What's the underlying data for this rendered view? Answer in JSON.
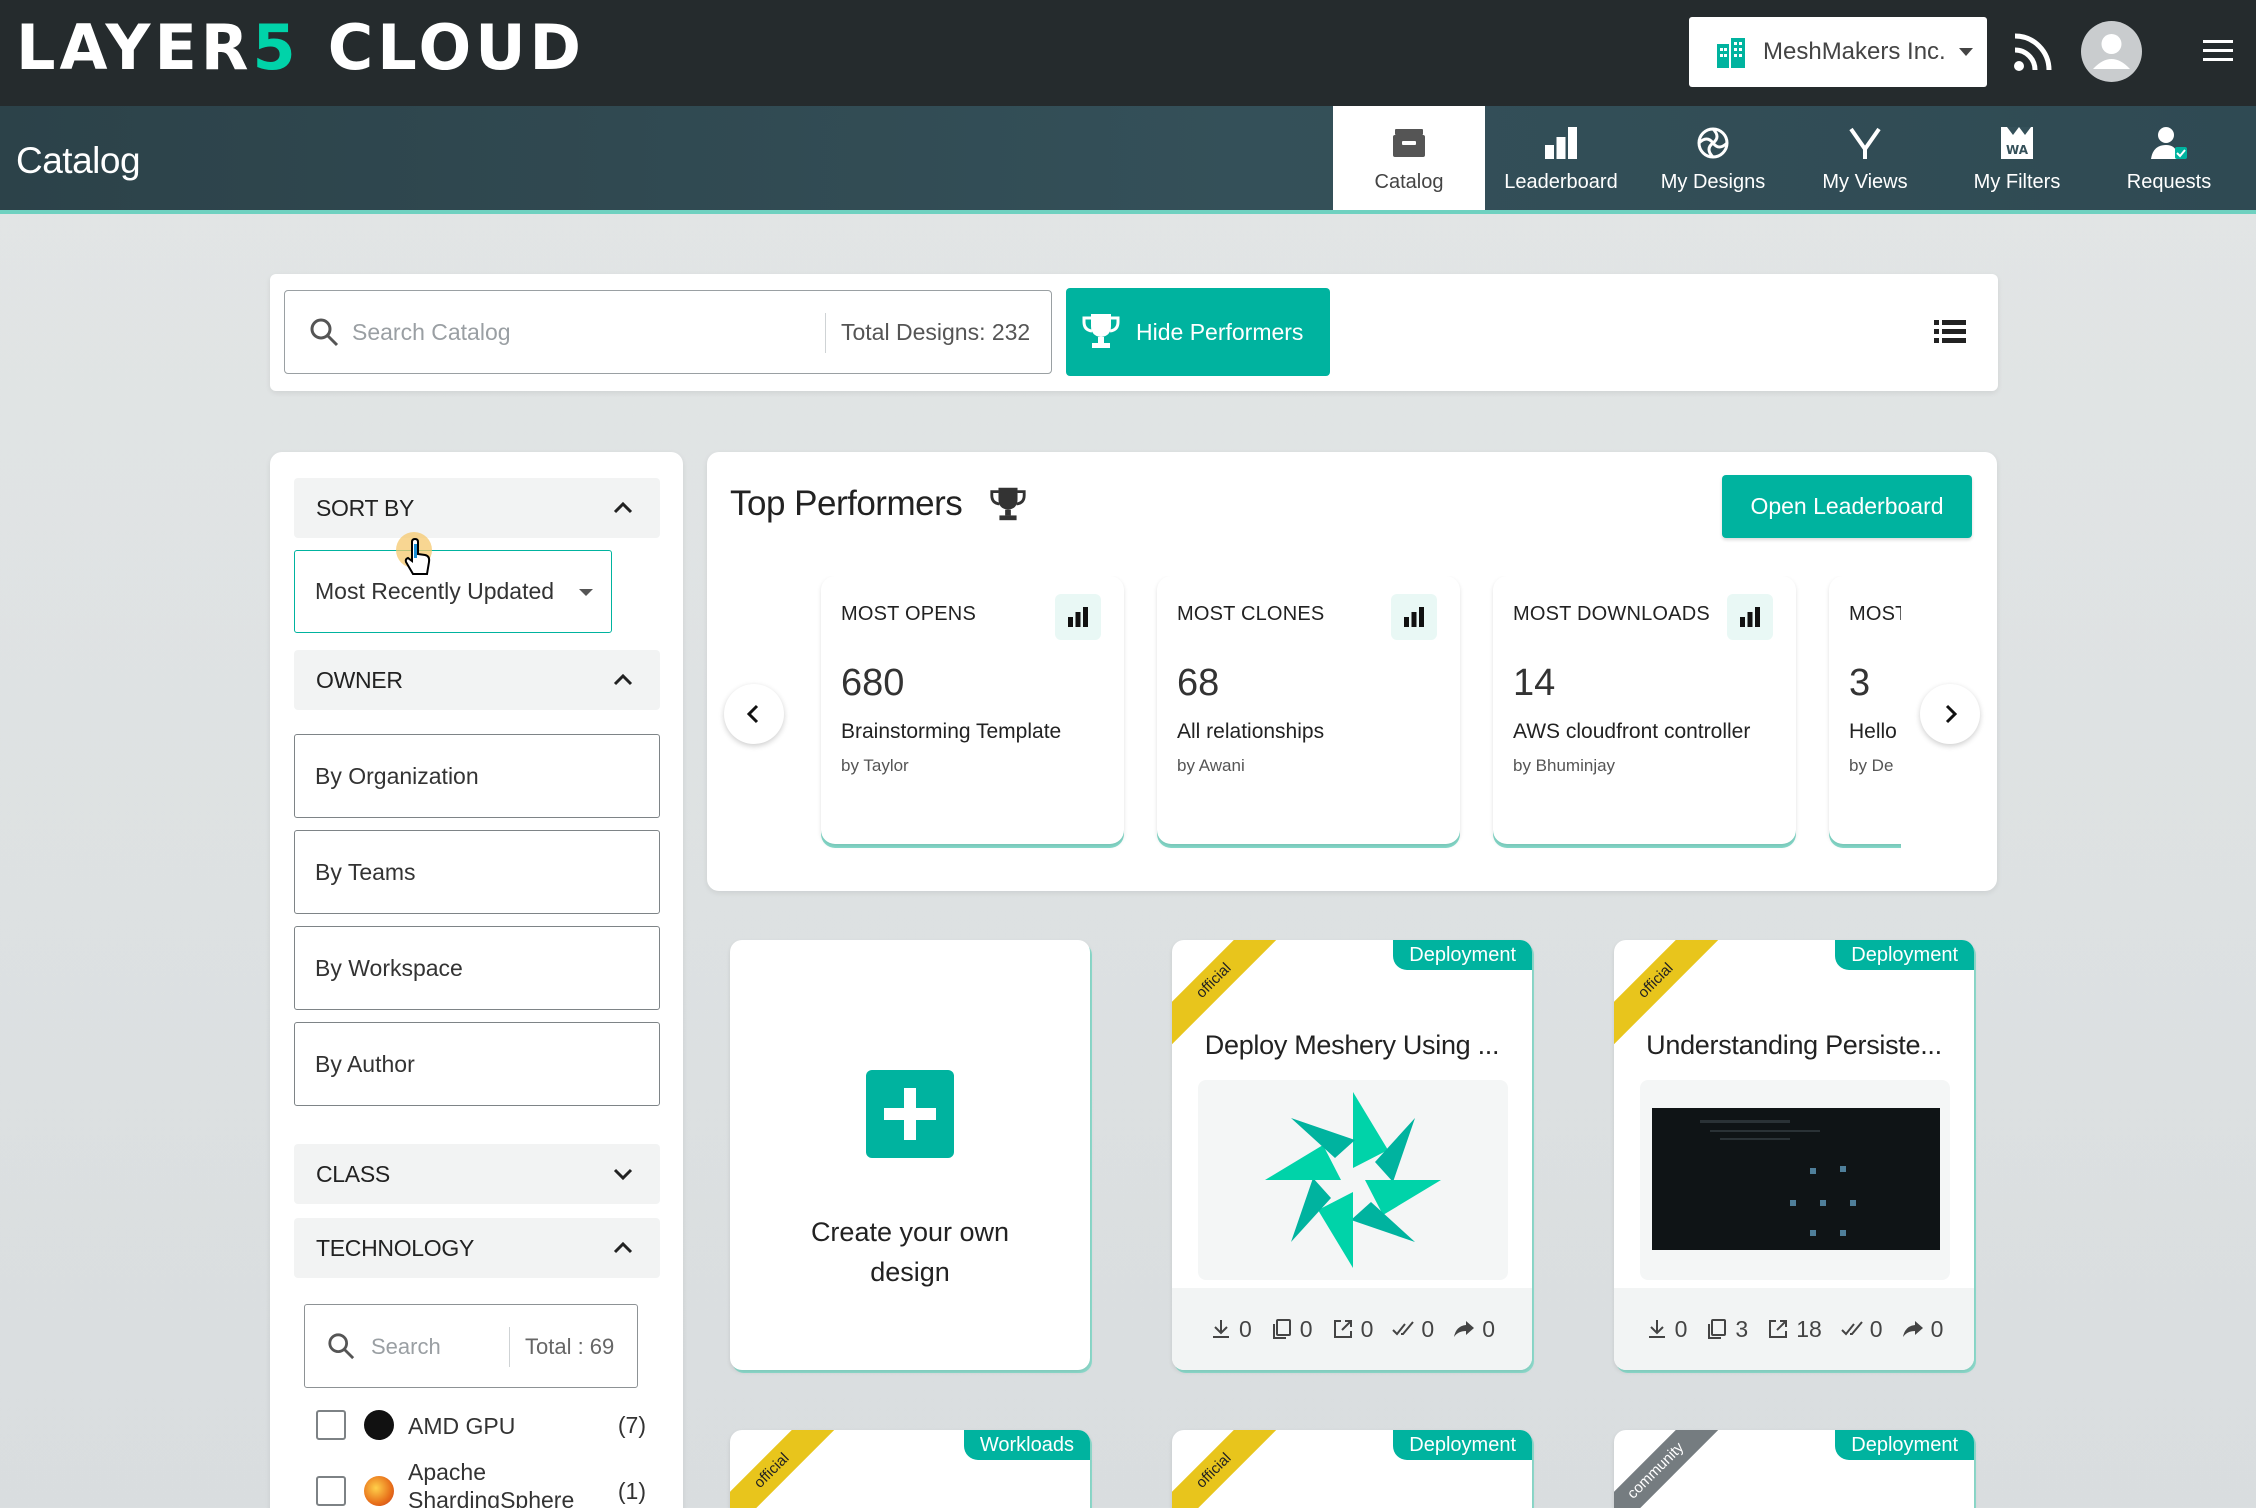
{
  "brand": {
    "logo_part1": "LAYER",
    "logo_five": "5",
    "logo_part2": "CLOUD"
  },
  "header": {
    "org_name": "MeshMakers Inc."
  },
  "page": {
    "title": "Catalog"
  },
  "nav": {
    "tabs": [
      {
        "label": "Catalog",
        "icon": "catalog-icon",
        "active": true
      },
      {
        "label": "Leaderboard",
        "icon": "leaderboard-icon"
      },
      {
        "label": "My Designs",
        "icon": "designs-icon"
      },
      {
        "label": "My Views",
        "icon": "views-icon"
      },
      {
        "label": "My Filters",
        "icon": "filters-icon"
      },
      {
        "label": "Requests",
        "icon": "requests-icon"
      }
    ]
  },
  "search": {
    "placeholder": "Search Catalog",
    "total": "Total Designs: 232",
    "hide_performers": "Hide Performers"
  },
  "sidebar": {
    "sort_by": "SORT BY",
    "sort_value": "Most Recently Updated",
    "owner": "OWNER",
    "owner_options": [
      "By Organization",
      "By Teams",
      "By Workspace",
      "By Author"
    ],
    "class": "CLASS",
    "technology": "TECHNOLOGY",
    "tech_search_placeholder": "Search",
    "tech_total": "Total : 69",
    "tech_items": [
      {
        "name": "AMD GPU",
        "count": "(7)"
      },
      {
        "name": "Apache ShardingSphere",
        "count": "(1)"
      }
    ]
  },
  "top_performers": {
    "title": "Top Performers",
    "open_leaderboard": "Open Leaderboard",
    "cards": [
      {
        "title": "MOST OPENS",
        "value": "680",
        "name": "Brainstorming Template",
        "by": "by Taylor"
      },
      {
        "title": "MOST CLONES",
        "value": "68",
        "name": "All relationships",
        "by": "by Awani"
      },
      {
        "title": "MOST DOWNLOADS",
        "value": "14",
        "name": "AWS cloudfront controller",
        "by": "by Bhuminjay"
      },
      {
        "title": "MOST VIEWS",
        "value": "3",
        "name": "Hello",
        "by": "by De"
      }
    ]
  },
  "create": {
    "line1": "Create your own",
    "line2": "design"
  },
  "designs": [
    {
      "ribbon": "official",
      "type": "Deployment",
      "title": "Deploy Meshery Using ...",
      "stats": [
        "0",
        "0",
        "0",
        "0",
        "0"
      ]
    },
    {
      "ribbon": "official",
      "type": "Deployment",
      "title": "Understanding Persiste...",
      "stats": [
        "0",
        "3",
        "18",
        "0",
        "0"
      ]
    },
    {
      "ribbon": "official",
      "type": "Workloads"
    },
    {
      "ribbon": "official",
      "type": "Deployment"
    },
    {
      "ribbon": "community",
      "type": "Deployment"
    }
  ],
  "colors": {
    "accent": "#00b39f",
    "header": "#252b2d",
    "subheader": "#345059",
    "official_ribbon": "#e8c51c"
  }
}
